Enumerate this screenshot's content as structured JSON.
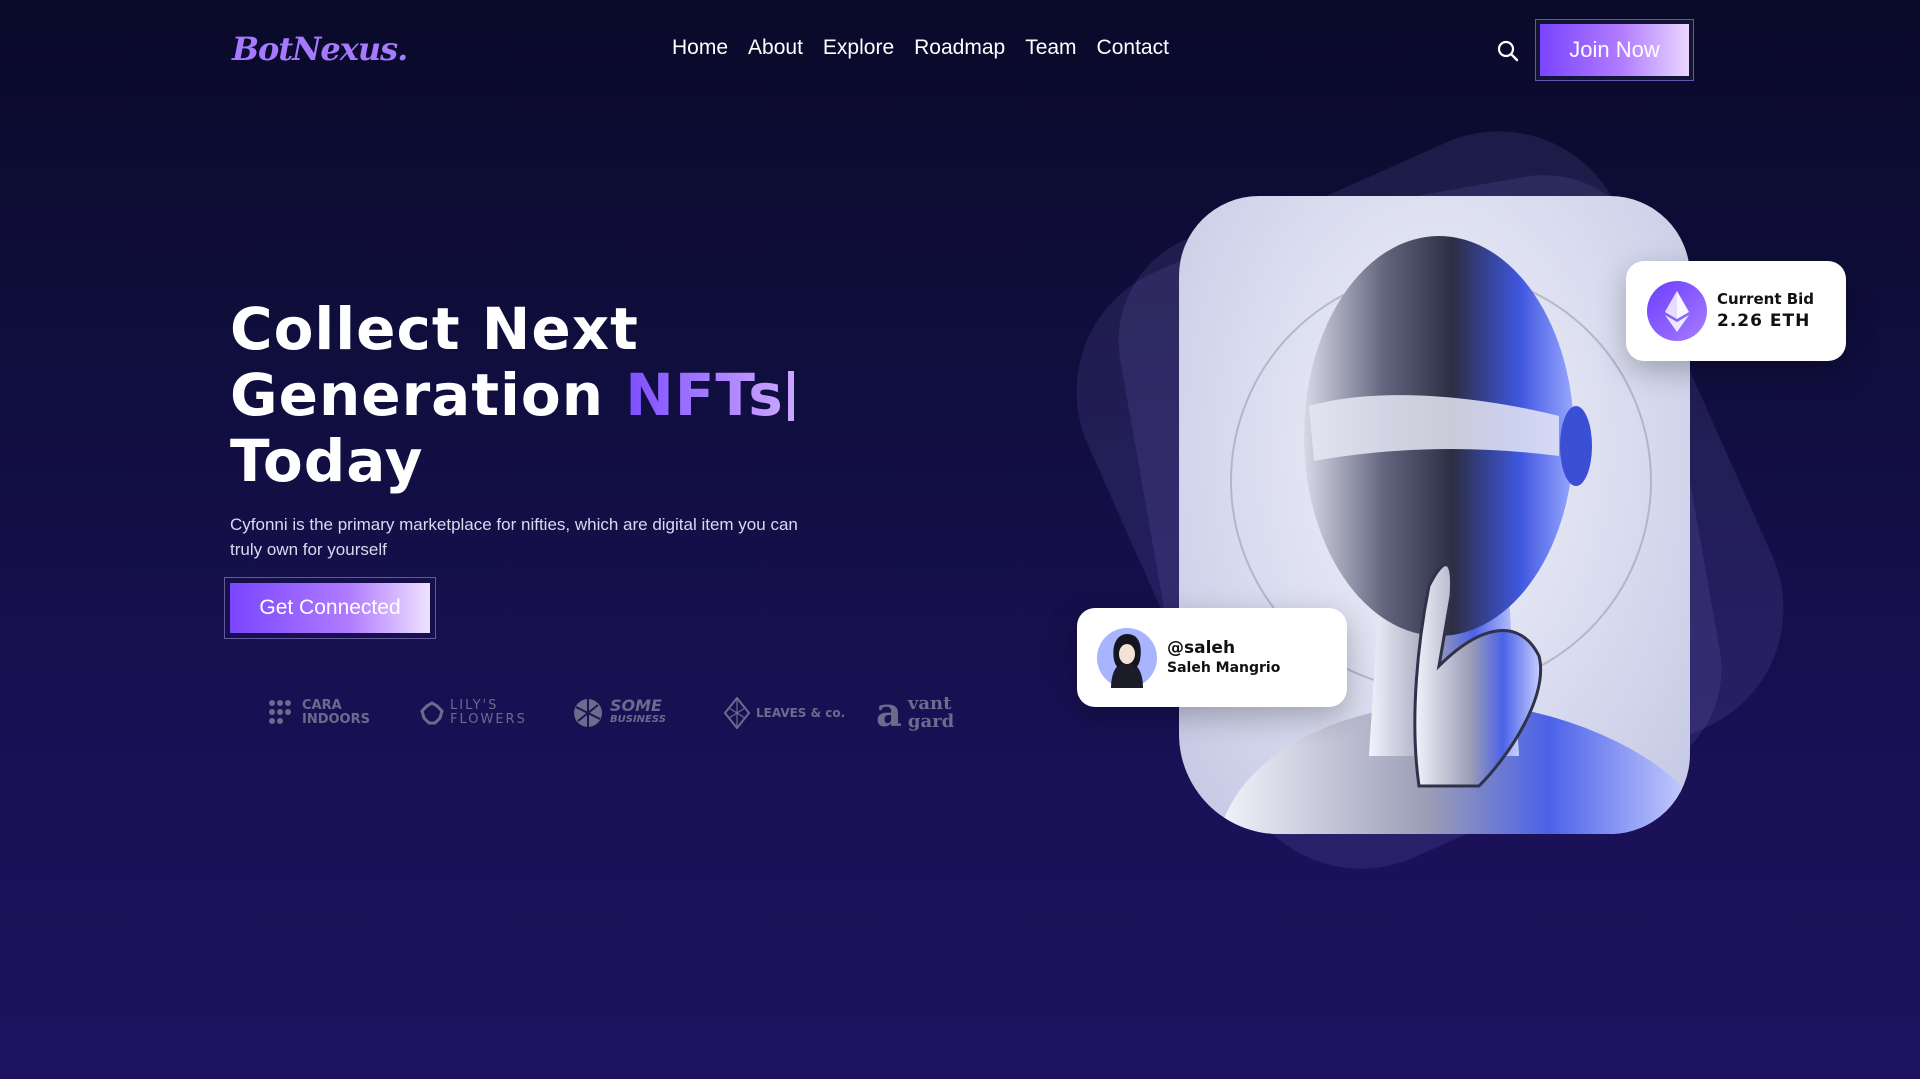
{
  "header": {
    "logo": "BotNexus.",
    "nav": [
      "Home",
      "About",
      "Explore",
      "Roadmap",
      "Team",
      "Contact"
    ],
    "join_label": "Join Now"
  },
  "hero": {
    "title_line1": "Collect Next",
    "title_line2_plain": "Generation ",
    "title_line2_accent": "NFTs",
    "title_line3": "Today",
    "description": "Cyfonni is the primary marketplace for nifties, which are digital item you can truly own for yourself",
    "cta_label": "Get Connected"
  },
  "partners": [
    {
      "name": "CARA INDOORS",
      "line1": "CARA",
      "line2": "INDOORS"
    },
    {
      "name": "LILY'S FLOWERS",
      "line1": "LILY'S",
      "line2": "FLOWERS"
    },
    {
      "name": "SOME BUSINESS",
      "line1": "SOME",
      "line2": "BUSINESS"
    },
    {
      "name": "LEAVES & CO.",
      "line1": "LEAVES & co.",
      "line2": ""
    },
    {
      "name": "avant garde",
      "line1": "vant",
      "line2": "gard"
    }
  ],
  "bid": {
    "label": "Current Bid",
    "value": "2.26 ETH"
  },
  "user": {
    "handle": "@saleh",
    "name": "Saleh Mangrio"
  },
  "colors": {
    "accent": "#7c4dff",
    "accent_light": "#c9a4ff",
    "bg_top": "#0a0a2a",
    "bg_bottom": "#1d125e",
    "eth_purple": "#7d4dff"
  },
  "icons": {
    "search": "search-icon",
    "eth": "ethereum-icon"
  }
}
